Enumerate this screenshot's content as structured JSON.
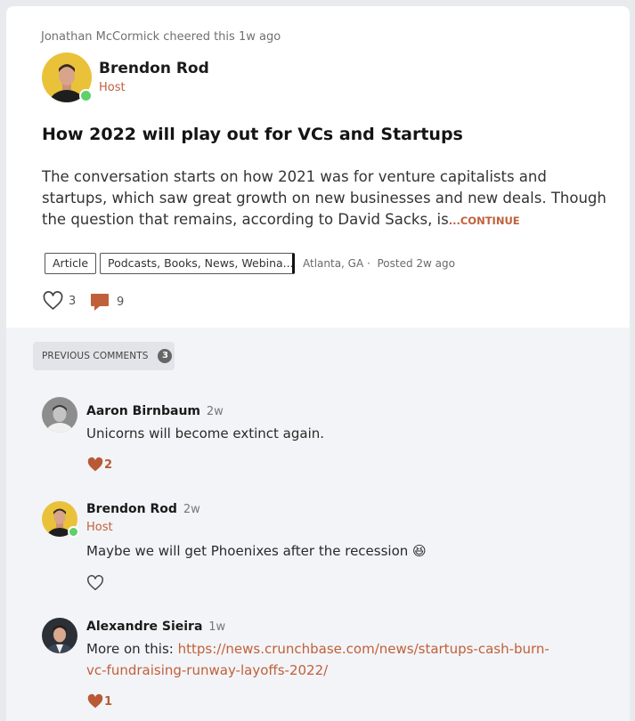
{
  "post": {
    "cheer_text": "Jonathan McCormick cheered this 1w ago",
    "author": {
      "name": "Brendon Rod",
      "role": "Host"
    },
    "title": "How 2022 will play out for VCs and Startups",
    "body": "The conversation starts on how 2021 was for venture capitalists and startups, which saw great growth on new businesses and new deals. Though the question that remains, according to David Sacks, is",
    "continue_label": "...CONTINUE",
    "tags": [
      "Article",
      "Podcasts, Books, News, Webina..."
    ],
    "location": "Atlanta, GA",
    "separator": "·",
    "posted": "Posted 2w ago",
    "likes": "3",
    "comments_count": "9"
  },
  "comments_section": {
    "previous_label": "PREVIOUS COMMENTS",
    "previous_count": "3",
    "items": [
      {
        "name": "Aaron Birnbaum",
        "time": "2w",
        "text": "Unicorns will become extinct again.",
        "likes": "2"
      },
      {
        "name": "Brendon Rod",
        "time": "2w",
        "role": "Host",
        "text": "Maybe we will get Phoenixes after the recession 😆",
        "likes": ""
      },
      {
        "name": "Alexandre Sieira",
        "time": "1w",
        "text_prefix": "More on this: ",
        "link": "https://news.crunchbase.com/news/startups-cash-burn-vc-fundraising-runway-layoffs-2022/",
        "likes": "1"
      }
    ]
  },
  "colors": {
    "accent": "#c0603a",
    "online": "#5fd06a",
    "comments_bg": "#f3f4f7"
  },
  "icons": [
    "heart-outline-icon",
    "comment-bubble-icon",
    "heart-filled-icon"
  ]
}
